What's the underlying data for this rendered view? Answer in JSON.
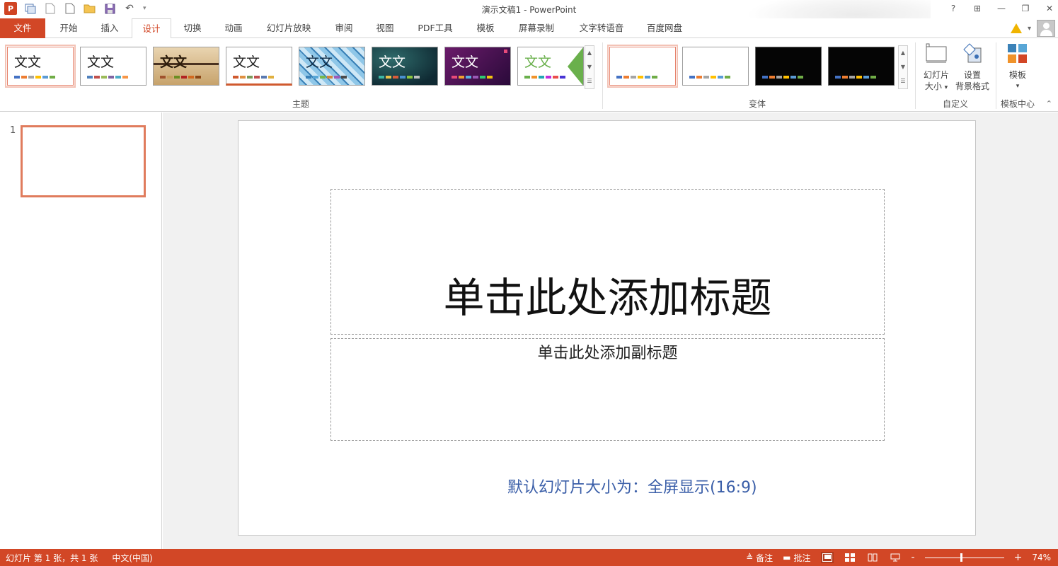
{
  "window": {
    "title": "演示文稿1 - PowerPoint",
    "controls": [
      "?",
      "⊞",
      "—",
      "❐",
      "✕"
    ]
  },
  "qat": {
    "logo": "P",
    "undo_symbol": "↶",
    "customize_symbol": "▾"
  },
  "tabs": [
    {
      "label": "文件"
    },
    {
      "label": "开始"
    },
    {
      "label": "插入"
    },
    {
      "label": "设计"
    },
    {
      "label": "切换"
    },
    {
      "label": "动画"
    },
    {
      "label": "幻灯片放映"
    },
    {
      "label": "审阅"
    },
    {
      "label": "视图"
    },
    {
      "label": "PDF工具"
    },
    {
      "label": "模板"
    },
    {
      "label": "屏幕录制"
    },
    {
      "label": "文字转语音"
    },
    {
      "label": "百度网盘"
    }
  ],
  "active_tab": "设计",
  "ribbon": {
    "themes_group_label": "主题",
    "variants_group_label": "变体",
    "customize_group_label": "自定义",
    "template_group_label": "模板中心",
    "theme_sample_text": "文文",
    "slide_size_label_1": "幻灯片",
    "slide_size_label_2": "大小",
    "bg_format_label_1": "设置",
    "bg_format_label_2": "背景格式",
    "template_label": "模板",
    "dropdown_symbol": "▾"
  },
  "theme_colors": {
    "office": [
      "#4472c4",
      "#ed7d31",
      "#a5a5a5",
      "#ffc000",
      "#5b9bd5",
      "#70ad47"
    ],
    "theme2": [
      "#4f81bd",
      "#c0504d",
      "#9bbb59",
      "#8064a2",
      "#4bacc6",
      "#f79646"
    ],
    "theme3": [
      "#a0522d",
      "#c8a060",
      "#6b8e23",
      "#b22222",
      "#d2691e",
      "#8b4513"
    ],
    "theme4": [
      "#d05a2f",
      "#e09040",
      "#7a9a5a",
      "#c05050",
      "#5a7ab0",
      "#e0b040"
    ],
    "theme5": [
      "#3b82b8",
      "#58a6d6",
      "#77b84a",
      "#d1843c",
      "#a05ab8",
      "#4a4a4a"
    ],
    "theme6": [
      "#3cb6a4",
      "#e8c24a",
      "#d85b3a",
      "#4a90d0",
      "#8dc63f",
      "#c0c0c0"
    ],
    "theme7": [
      "#e84a7a",
      "#f0a030",
      "#5ab0e0",
      "#9b59b6",
      "#2ecc71",
      "#f1c40f"
    ],
    "theme8": [
      "#6ab04c",
      "#f0932b",
      "#22a6b3",
      "#be2edd",
      "#eb4d4b",
      "#4834d4"
    ]
  },
  "variant_colors": [
    "#4472c4",
    "#ed7d31",
    "#a5a5a5",
    "#ffc000",
    "#5b9bd5",
    "#70ad47"
  ],
  "slide_pane": {
    "slide_number": "1"
  },
  "slide": {
    "title_placeholder": "单击此处添加标题",
    "subtitle_placeholder": "单击此处添加副标题",
    "annotation": "默认幻灯片大小为：全屏显示(16:9)"
  },
  "statusbar": {
    "slide_info": "幻灯片 第 1 张，共 1 张",
    "language": "中文(中国)",
    "notes_label": "备注",
    "comments_label": "批注",
    "zoom_minus": "-",
    "zoom_plus": "+",
    "zoom_level": "74%"
  }
}
